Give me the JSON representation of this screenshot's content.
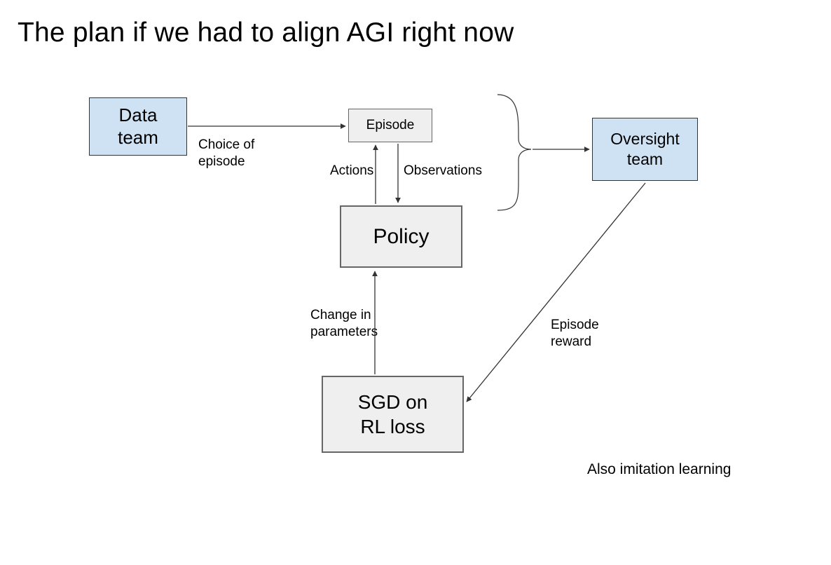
{
  "title": "The plan if we had to align AGI right now",
  "boxes": {
    "data_team": "Data\nteam",
    "episode": "Episode",
    "oversight_team": "Oversight\nteam",
    "policy": "Policy",
    "sgd": "SGD on\nRL loss"
  },
  "labels": {
    "choice_of_episode": "Choice of\nepisode",
    "actions": "Actions",
    "observations": "Observations",
    "change_in_parameters": "Change in\nparameters",
    "episode_reward": "Episode\nreward"
  },
  "footnote": "Also imitation learning"
}
